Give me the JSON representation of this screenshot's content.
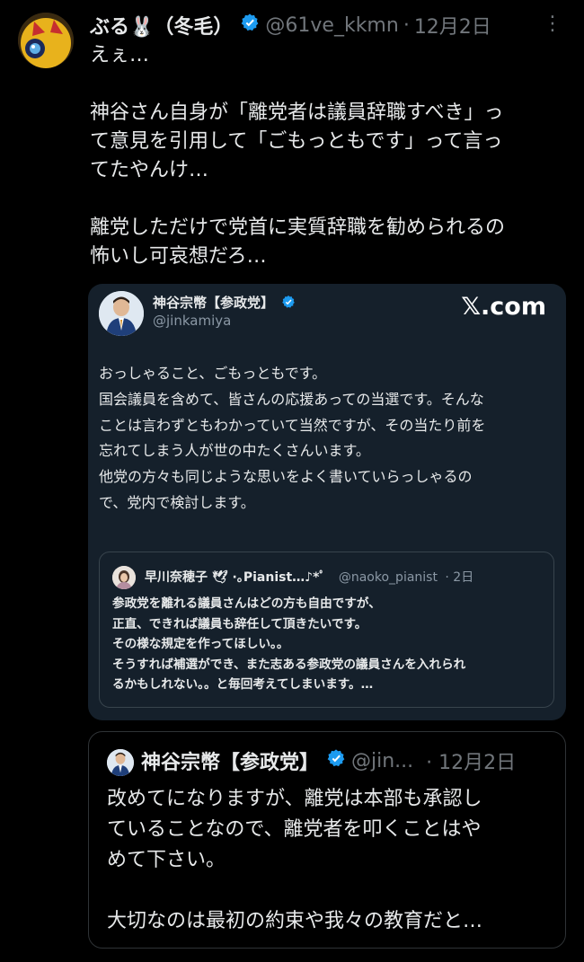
{
  "tweet": {
    "author_name": "ぶる🐰（冬毛）",
    "author_handle": "@61ve_kkmn",
    "separator": "·",
    "date": "12月2日",
    "more_icon": "⋮",
    "text_lines": [
      "えぇ…",
      "神谷さん自身が「離党者は議員辞職すべき」っ",
      "て意見を引用して「ごもっともです」って言っ",
      "てたやんけ…",
      "離党しただけで党首に実質辞職を勧められるの",
      "怖いし可哀想だろ…"
    ]
  },
  "embed_card": {
    "author_name": "神谷宗幣【参政党】",
    "author_handle": "@jinkamiya",
    "site_label": "𝕏.com",
    "body_lines": [
      "おっしゃること、ごもっともです。",
      "国会議員を含めて、皆さんの応援あっての当選です。そんな",
      "ことは言わずともわかっていて当然ですが、その当たり前を",
      "忘れてしまう人が世の中たくさんいます。",
      "他党の方々も同じような思いをよく書いていらっしゃるの",
      "で、党内で検討します。"
    ],
    "quote": {
      "author_name": "早川奈穂子 🕊 ·｡Pianist…♪*ﾟ",
      "author_handle": "@naoko_pianist",
      "date": "· 2日",
      "body_lines": [
        "参政党を離れる議員さんはどの方も自由ですが、",
        "正直、できれば議員も辞任して頂きたいです。",
        "その様な規定を作ってほしい。。",
        "そうすれば補選ができ、また志ある参政党の議員さんを入れられ",
        "るかもしれない。。と毎回考えてしまいます。…"
      ]
    }
  },
  "quoted_tweet": {
    "author_name": "神谷宗幣【参政党】",
    "author_handle": "@jin...",
    "date": "· 12月2日",
    "body_lines": [
      "改めてになりますが、離党は本部も承認し",
      "ていることなので、離党者を叩くことはや",
      "めて下さい。",
      "大切なのは最初の約束や我々の教育だと…"
    ]
  },
  "colors": {
    "background": "#000000",
    "card": "#15202b",
    "verified": "#1d9bf0",
    "muted": "#71767b"
  }
}
